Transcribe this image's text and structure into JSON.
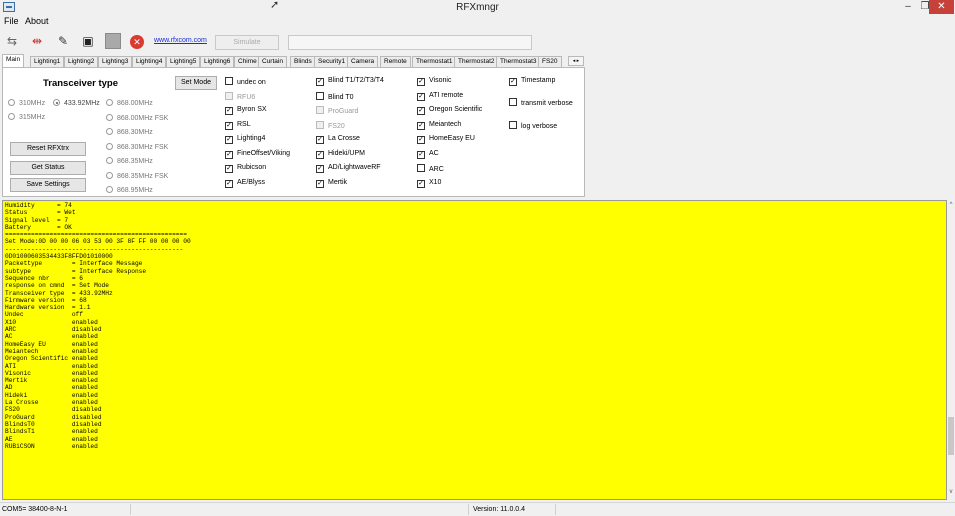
{
  "window": {
    "title": "RFXmngr",
    "min": "–",
    "max": "❐",
    "close": "✕"
  },
  "menu": {
    "file": "File",
    "about": "About"
  },
  "toolbar": {
    "link": "www.rfxcom.com",
    "simulate": "Simulate",
    "simulate_value": ""
  },
  "tabs": [
    "Main",
    "Lighting1",
    "Lighting2",
    "Lighting3",
    "Lighting4",
    "Lighting5",
    "Lighting6",
    "Chime",
    "Curtain",
    "Blinds",
    "Security1",
    "Camera",
    "Remote",
    "Thermostat1",
    "Thermostat2",
    "Thermostat3",
    "FS20"
  ],
  "tab_scroll": "◂ ▸",
  "main": {
    "transceiver_title": "Transceiver type",
    "set_mode": "Set Mode",
    "reset": "Reset RFXtrx",
    "get_status": "Get Status",
    "save_settings": "Save Settings",
    "freq_left": [
      {
        "label": "310MHz",
        "checked": false
      },
      {
        "label": "433.92MHz",
        "checked": true
      },
      {
        "label": "315MHz",
        "checked": false
      }
    ],
    "freq_right": [
      "868.00MHz",
      "868.00MHz FSK",
      "868.30MHz",
      "868.30MHz FSK",
      "868.35MHz",
      "868.35MHz FSK",
      "868.95MHz"
    ],
    "col1": [
      {
        "label": "undec on",
        "checked": false,
        "disabled": false
      },
      {
        "label": "RFU6",
        "checked": false,
        "disabled": true
      },
      {
        "label": "Byron SX",
        "checked": true,
        "disabled": false
      },
      {
        "label": "RSL",
        "checked": true,
        "disabled": false
      },
      {
        "label": "Lighting4",
        "checked": true,
        "disabled": false
      },
      {
        "label": "FineOffset/Viking",
        "checked": true,
        "disabled": false
      },
      {
        "label": "Rubicson",
        "checked": true,
        "disabled": false
      },
      {
        "label": "AE/Blyss",
        "checked": true,
        "disabled": false
      }
    ],
    "col2": [
      {
        "label": "Blind T1/T2/T3/T4",
        "checked": true,
        "disabled": false
      },
      {
        "label": "Blind T0",
        "checked": false,
        "disabled": false
      },
      {
        "label": "ProGuard",
        "checked": false,
        "disabled": true
      },
      {
        "label": "FS20",
        "checked": false,
        "disabled": true
      },
      {
        "label": "La Crosse",
        "checked": true,
        "disabled": false
      },
      {
        "label": "Hideki/UPM",
        "checked": true,
        "disabled": false
      },
      {
        "label": "AD/LightwaveRF",
        "checked": true,
        "disabled": false
      },
      {
        "label": "Mertik",
        "checked": true,
        "disabled": false
      }
    ],
    "col3": [
      {
        "label": "Visonic",
        "checked": true,
        "disabled": false
      },
      {
        "label": "ATI remote",
        "checked": true,
        "disabled": false
      },
      {
        "label": "Oregon Scientific",
        "checked": true,
        "disabled": false
      },
      {
        "label": "Meiantech",
        "checked": true,
        "disabled": false
      },
      {
        "label": "HomeEasy EU",
        "checked": true,
        "disabled": false
      },
      {
        "label": "AC",
        "checked": true,
        "disabled": false
      },
      {
        "label": "ARC",
        "checked": false,
        "disabled": false
      },
      {
        "label": "X10",
        "checked": true,
        "disabled": false
      }
    ],
    "col4": [
      {
        "label": "Timestamp",
        "checked": true,
        "disabled": false
      },
      {
        "label": "transmit verbose",
        "checked": false,
        "disabled": false
      },
      {
        "label": "log verbose",
        "checked": false,
        "disabled": false
      }
    ]
  },
  "log": "Humidity      = 74\nStatus        = Wet\nSignal level  = 7\nBattery       = OK\n=================================================\nSet Mode:0D 00 00 06 03 53 00 3F 8F FF 00 00 00 00\n------------------------------------------------\n0D01000603534433F8FFD01010000\nPackettype        = Interface Message\nsubtype           = Interface Response\nSequence nbr      = 6\nresponse on cmnd  = Set Mode\nTransceiver type  = 433.92MHz\nFirmware version  = 68\nHardware version  = 1.1\nUndec             off\nX10               enabled\nARC               disabled\nAC                enabled\nHomeEasy EU       enabled\nMeiantech         enabled\nOregon Scientific enabled\nATI               enabled\nVisonic           enabled\nMertik            enabled\nAD                enabled\nHideki            enabled\nLa Crosse         enabled\nFS20              disabled\nProGuard          disabled\nBlindsT0          disabled\nBlindsT1          enabled\nAE                enabled\nRUBiCSON          enabled",
  "statusbar": {
    "port": "COM5= 38400-8-N-1",
    "version": "Version: 11.0.0.4"
  }
}
